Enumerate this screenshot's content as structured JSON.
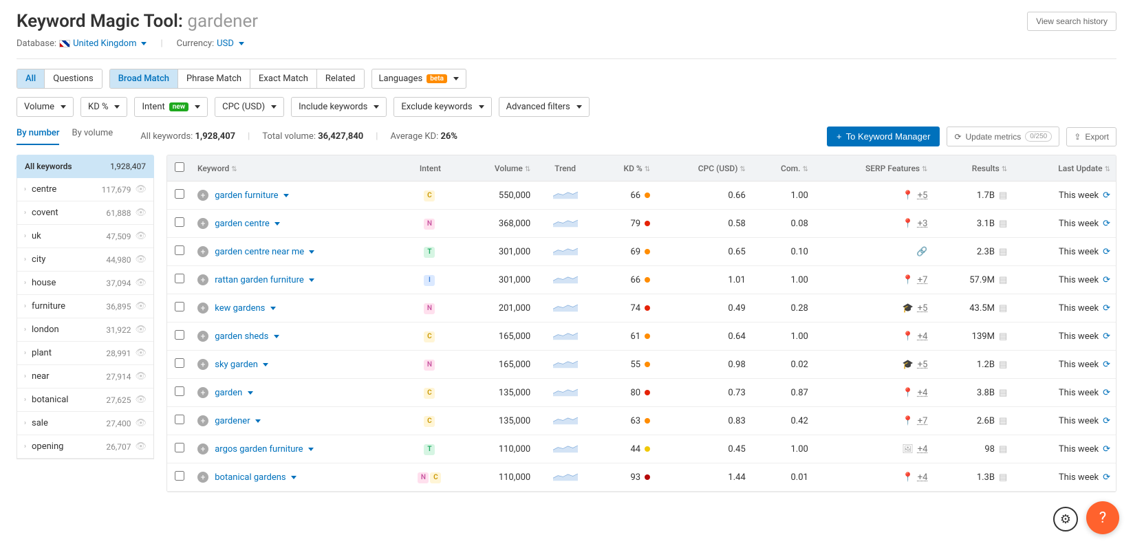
{
  "page": {
    "title_prefix": "Keyword Magic Tool: ",
    "query": "gardener",
    "view_history": "View search history"
  },
  "meta": {
    "db_label": "Database:",
    "db_value": "United Kingdom",
    "currency_label": "Currency:",
    "currency_value": "USD"
  },
  "match_tabs": {
    "all": "All",
    "questions": "Questions",
    "broad": "Broad Match",
    "phrase": "Phrase Match",
    "exact": "Exact Match",
    "related": "Related"
  },
  "lang_btn": "Languages",
  "beta": "beta",
  "filters": {
    "volume": "Volume",
    "kd": "KD %",
    "intent": "Intent",
    "new": "new",
    "cpc": "CPC (USD)",
    "include": "Include keywords",
    "exclude": "Exclude keywords",
    "advanced": "Advanced filters"
  },
  "view_tabs": {
    "by_number": "By number",
    "by_volume": "By volume"
  },
  "stats": {
    "all_kw_label": "All keywords:",
    "all_kw": "1,928,407",
    "total_vol_label": "Total volume:",
    "total_vol": "36,427,840",
    "avg_kd_label": "Average KD:",
    "avg_kd": "26%"
  },
  "actions": {
    "to_km": "To Keyword Manager",
    "update": "Update metrics",
    "update_counter": "0/250",
    "export": "Export"
  },
  "sidebar": {
    "head_label": "All keywords",
    "head_count": "1,928,407",
    "items": [
      {
        "label": "centre",
        "count": "117,679"
      },
      {
        "label": "covent",
        "count": "61,888"
      },
      {
        "label": "uk",
        "count": "47,509"
      },
      {
        "label": "city",
        "count": "44,980"
      },
      {
        "label": "house",
        "count": "37,094"
      },
      {
        "label": "furniture",
        "count": "36,895"
      },
      {
        "label": "london",
        "count": "31,922"
      },
      {
        "label": "plant",
        "count": "28,991"
      },
      {
        "label": "near",
        "count": "27,914"
      },
      {
        "label": "botanical",
        "count": "27,625"
      },
      {
        "label": "sale",
        "count": "27,400"
      },
      {
        "label": "opening",
        "count": "26,707"
      }
    ]
  },
  "columns": {
    "keyword": "Keyword",
    "intent": "Intent",
    "volume": "Volume",
    "trend": "Trend",
    "kd": "KD %",
    "cpc": "CPC (USD)",
    "com": "Com.",
    "serp": "SERP Features",
    "results": "Results",
    "updated": "Last Update"
  },
  "rows": [
    {
      "kw": "garden furniture",
      "intent": [
        "C"
      ],
      "volume": "550,000",
      "kd": 66,
      "kdColor": "#ff8c00",
      "cpc": "0.66",
      "com": "1.00",
      "serp_icon": "pin",
      "serp": "+5",
      "results": "1.7B",
      "updated": "This week"
    },
    {
      "kw": "garden centre",
      "intent": [
        "N"
      ],
      "volume": "368,000",
      "kd": 79,
      "kdColor": "#e52207",
      "cpc": "0.58",
      "com": "0.08",
      "serp_icon": "pin",
      "serp": "+3",
      "results": "3.1B",
      "updated": "This week"
    },
    {
      "kw": "garden centre near me",
      "intent": [
        "T"
      ],
      "volume": "301,000",
      "kd": 69,
      "kdColor": "#ff8c00",
      "cpc": "0.65",
      "com": "0.10",
      "serp_icon": "link",
      "serp": "",
      "results": "2.3B",
      "updated": "This week"
    },
    {
      "kw": "rattan garden furniture",
      "intent": [
        "I"
      ],
      "volume": "301,000",
      "kd": 66,
      "kdColor": "#ff8c00",
      "cpc": "1.01",
      "com": "1.00",
      "serp_icon": "pin",
      "serp": "+7",
      "results": "57.9M",
      "updated": "This week"
    },
    {
      "kw": "kew gardens",
      "intent": [
        "N"
      ],
      "volume": "201,000",
      "kd": 74,
      "kdColor": "#e52207",
      "cpc": "0.49",
      "com": "0.28",
      "serp_icon": "grad",
      "serp": "+5",
      "results": "43.5M",
      "updated": "This week"
    },
    {
      "kw": "garden sheds",
      "intent": [
        "C"
      ],
      "volume": "165,000",
      "kd": 61,
      "kdColor": "#ff8c00",
      "cpc": "0.64",
      "com": "1.00",
      "serp_icon": "pin",
      "serp": "+4",
      "results": "139M",
      "updated": "This week"
    },
    {
      "kw": "sky garden",
      "intent": [
        "N"
      ],
      "volume": "165,000",
      "kd": 55,
      "kdColor": "#ff8c00",
      "cpc": "0.98",
      "com": "0.02",
      "serp_icon": "grad",
      "serp": "+5",
      "results": "1.2B",
      "updated": "This week"
    },
    {
      "kw": "garden",
      "intent": [
        "C"
      ],
      "volume": "135,000",
      "kd": 80,
      "kdColor": "#e52207",
      "cpc": "0.73",
      "com": "0.87",
      "serp_icon": "pin",
      "serp": "+4",
      "results": "3.8B",
      "updated": "This week"
    },
    {
      "kw": "gardener",
      "intent": [
        "C"
      ],
      "volume": "135,000",
      "kd": 63,
      "kdColor": "#ff8c00",
      "cpc": "0.83",
      "com": "0.42",
      "serp_icon": "pin",
      "serp": "+7",
      "results": "2.6B",
      "updated": "This week"
    },
    {
      "kw": "argos garden furniture",
      "intent": [
        "T"
      ],
      "volume": "110,000",
      "kd": 44,
      "kdColor": "#f0c808",
      "cpc": "0.45",
      "com": "1.00",
      "serp_icon": "img",
      "serp": "+4",
      "results": "98",
      "updated": "This week"
    },
    {
      "kw": "botanical gardens",
      "intent": [
        "N",
        "C"
      ],
      "volume": "110,000",
      "kd": 93,
      "kdColor": "#b50909",
      "cpc": "1.44",
      "com": "0.01",
      "serp_icon": "pin",
      "serp": "+4",
      "results": "1.3B",
      "updated": "This week"
    }
  ]
}
